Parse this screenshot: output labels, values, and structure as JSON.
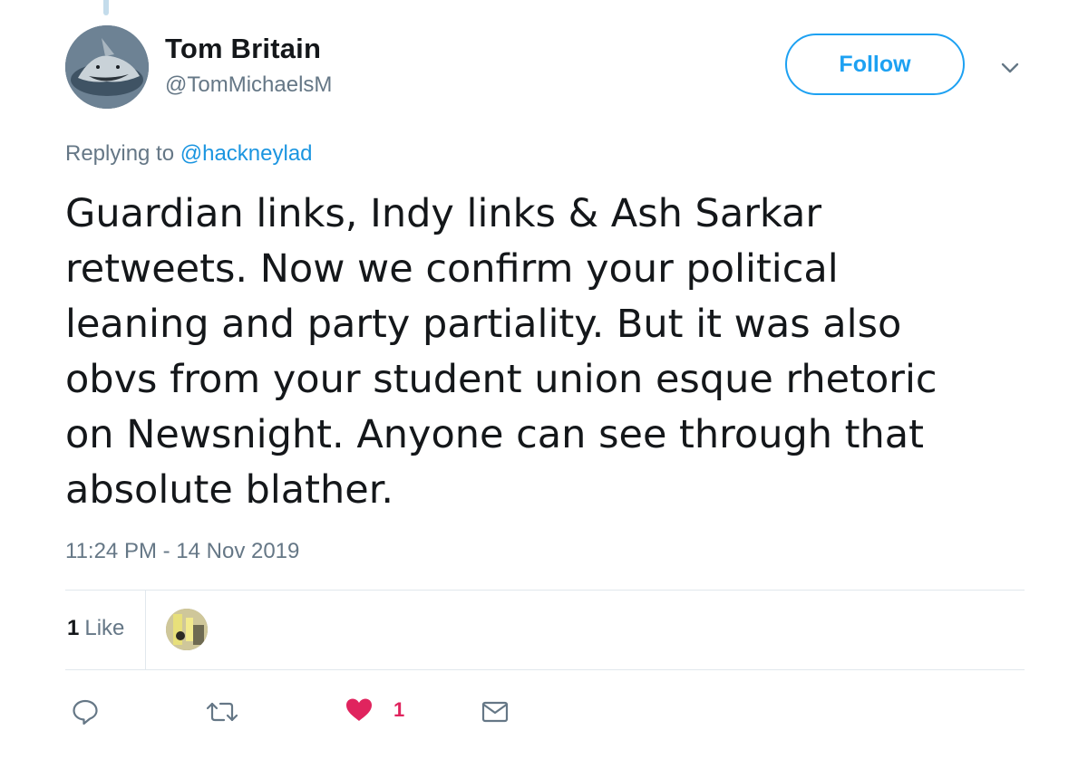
{
  "tweet": {
    "author_name": "Tom Britain",
    "author_handle": "@TomMichaelsM",
    "follow_label": "Follow",
    "replying_prefix": "Replying to",
    "replying_to": "@hackneylad",
    "text": "Guardian links, Indy links & Ash Sarkar\nretweets. Now we confirm your political\nleaning and party partiality. But it was also\nobvs from your student union esque rhetoric\non Newsnight. Anyone can see through that\nabsolute blather.",
    "timestamp": "11:24 PM - 14 Nov 2019"
  },
  "stats": {
    "likes_number": "1",
    "likes_label": "Like"
  },
  "actions": {
    "like_count": "1"
  },
  "icons": {
    "reply": "reply-icon",
    "retweet": "retweet-icon",
    "like": "heart-icon",
    "dm": "envelope-icon",
    "more": "chevron-down-icon"
  },
  "colors": {
    "accent": "#1da1f2",
    "mention": "#1b95e0",
    "secondary_text": "#657786",
    "like": "#e0245e",
    "divider": "#e1e8ed"
  }
}
